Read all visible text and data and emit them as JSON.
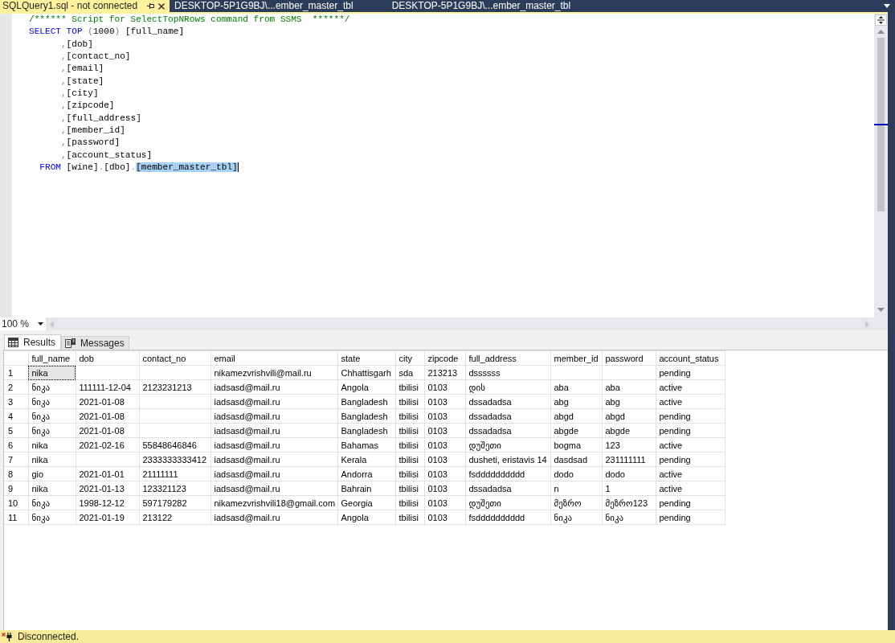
{
  "document_tabs": [
    {
      "label": "SQLQuery1.sql - not connected",
      "selected": true
    },
    {
      "label": "DESKTOP-5P1G9BJ\\...ember_master_tbl",
      "selected": false
    },
    {
      "label": "DESKTOP-5P1G9BJ\\...ember_master_tbl",
      "selected": false
    }
  ],
  "editor": {
    "lines": [
      {
        "tokens": [
          {
            "kind": "comment",
            "text": "/****** Script for SelectTopNRows command from SSMS  ******/",
            "selected": false
          }
        ]
      },
      {
        "tokens": [
          {
            "kind": "keyword",
            "text": "SELECT TOP",
            "selected": false
          },
          {
            "kind": "punct",
            "text": " (",
            "selected": false
          },
          {
            "kind": "plain",
            "text": "1000",
            "selected": false
          },
          {
            "kind": "punct",
            "text": ")",
            "selected": false
          },
          {
            "kind": "plain",
            "text": " [full_name]",
            "selected": false
          }
        ]
      },
      {
        "tokens": [
          {
            "kind": "punct",
            "text": "      ,",
            "selected": false
          },
          {
            "kind": "plain",
            "text": "[dob]",
            "selected": false
          }
        ]
      },
      {
        "tokens": [
          {
            "kind": "punct",
            "text": "      ,",
            "selected": false
          },
          {
            "kind": "plain",
            "text": "[contact_no]",
            "selected": false
          }
        ]
      },
      {
        "tokens": [
          {
            "kind": "punct",
            "text": "      ,",
            "selected": false
          },
          {
            "kind": "plain",
            "text": "[email]",
            "selected": false
          }
        ]
      },
      {
        "tokens": [
          {
            "kind": "punct",
            "text": "      ,",
            "selected": false
          },
          {
            "kind": "plain",
            "text": "[state]",
            "selected": false
          }
        ]
      },
      {
        "tokens": [
          {
            "kind": "punct",
            "text": "      ,",
            "selected": false
          },
          {
            "kind": "plain",
            "text": "[city]",
            "selected": false
          }
        ]
      },
      {
        "tokens": [
          {
            "kind": "punct",
            "text": "      ,",
            "selected": false
          },
          {
            "kind": "plain",
            "text": "[zipcode]",
            "selected": false
          }
        ]
      },
      {
        "tokens": [
          {
            "kind": "punct",
            "text": "      ,",
            "selected": false
          },
          {
            "kind": "plain",
            "text": "[full_address]",
            "selected": false
          }
        ]
      },
      {
        "tokens": [
          {
            "kind": "punct",
            "text": "      ,",
            "selected": false
          },
          {
            "kind": "plain",
            "text": "[member_id]",
            "selected": false
          }
        ]
      },
      {
        "tokens": [
          {
            "kind": "punct",
            "text": "      ,",
            "selected": false
          },
          {
            "kind": "plain",
            "text": "[password]",
            "selected": false
          }
        ]
      },
      {
        "tokens": [
          {
            "kind": "punct",
            "text": "      ,",
            "selected": false
          },
          {
            "kind": "plain",
            "text": "[account_status]",
            "selected": false
          }
        ]
      },
      {
        "tokens": [
          {
            "kind": "keyword",
            "text": "  FROM",
            "selected": false
          },
          {
            "kind": "plain",
            "text": " [wine]",
            "selected": false
          },
          {
            "kind": "punct",
            "text": ".",
            "selected": false
          },
          {
            "kind": "plain",
            "text": "[dbo]",
            "selected": false
          },
          {
            "kind": "punct",
            "text": ".",
            "selected": false
          },
          {
            "kind": "plain",
            "text": "[member_master_tbl]",
            "selected": true
          }
        ]
      }
    ]
  },
  "zoom": {
    "value": "100 %"
  },
  "result_tabs": [
    {
      "label": "Results",
      "kind": "grid",
      "selected": true
    },
    {
      "label": "Messages",
      "kind": "messages",
      "selected": false
    }
  ],
  "results": {
    "columns": [
      "full_name",
      "dob",
      "contact_no",
      "email",
      "state",
      "city",
      "zipcode",
      "full_address",
      "member_id",
      "password",
      "account_status"
    ],
    "rows": [
      {
        "number": "1",
        "cells": [
          {
            "text": "nika",
            "selected": true
          },
          {
            "selected": false
          },
          {
            "selected": false
          },
          {
            "text": "nikamezvrishvili@mail.ru",
            "selected": false
          },
          {
            "text": "Chhattisgarh",
            "selected": false
          },
          {
            "text": "sda",
            "selected": false
          },
          {
            "text": "213213",
            "selected": false
          },
          {
            "text": "dssssss",
            "selected": false
          },
          {
            "selected": false
          },
          {
            "selected": false
          },
          {
            "text": "pending",
            "selected": false
          }
        ]
      },
      {
        "number": "2",
        "cells": [
          {
            "text": "ნიკა",
            "selected": false
          },
          {
            "text": "111111-12-04",
            "selected": false
          },
          {
            "text": "2123231213",
            "selected": false
          },
          {
            "text": "iadsasd@mail.ru",
            "selected": false
          },
          {
            "text": "Angola",
            "selected": false
          },
          {
            "text": "tbilisi",
            "selected": false
          },
          {
            "text": "0103",
            "selected": false
          },
          {
            "text": "დის",
            "selected": false
          },
          {
            "text": "aba",
            "selected": false
          },
          {
            "text": "aba",
            "selected": false
          },
          {
            "text": "active",
            "selected": false
          }
        ]
      },
      {
        "number": "3",
        "cells": [
          {
            "text": "ნიკა",
            "selected": false
          },
          {
            "text": "2021-01-08",
            "selected": false
          },
          {
            "selected": false
          },
          {
            "text": "iadsasd@mail.ru",
            "selected": false
          },
          {
            "text": "Bangladesh",
            "selected": false
          },
          {
            "text": "tbilisi",
            "selected": false
          },
          {
            "text": "0103",
            "selected": false
          },
          {
            "text": "dssadadsa",
            "selected": false
          },
          {
            "text": "abg",
            "selected": false
          },
          {
            "text": "abg",
            "selected": false
          },
          {
            "text": "active",
            "selected": false
          }
        ]
      },
      {
        "number": "4",
        "cells": [
          {
            "text": "ნიკა",
            "selected": false
          },
          {
            "text": "2021-01-08",
            "selected": false
          },
          {
            "selected": false
          },
          {
            "text": "iadsasd@mail.ru",
            "selected": false
          },
          {
            "text": "Bangladesh",
            "selected": false
          },
          {
            "text": "tbilisi",
            "selected": false
          },
          {
            "text": "0103",
            "selected": false
          },
          {
            "text": "dssadadsa",
            "selected": false
          },
          {
            "text": "abgd",
            "selected": false
          },
          {
            "text": "abgd",
            "selected": false
          },
          {
            "text": "pending",
            "selected": false
          }
        ]
      },
      {
        "number": "5",
        "cells": [
          {
            "text": "ნიკა",
            "selected": false
          },
          {
            "text": "2021-01-08",
            "selected": false
          },
          {
            "selected": false
          },
          {
            "text": "iadsasd@mail.ru",
            "selected": false
          },
          {
            "text": "Bangladesh",
            "selected": false
          },
          {
            "text": "tbilisi",
            "selected": false
          },
          {
            "text": "0103",
            "selected": false
          },
          {
            "text": "dssadadsa",
            "selected": false
          },
          {
            "text": "abgde",
            "selected": false
          },
          {
            "text": "abgde",
            "selected": false
          },
          {
            "text": "pending",
            "selected": false
          }
        ]
      },
      {
        "number": "6",
        "cells": [
          {
            "text": "nika",
            "selected": false
          },
          {
            "text": "2021-02-16",
            "selected": false
          },
          {
            "text": "55848646846",
            "selected": false
          },
          {
            "text": "iadsasd@mail.ru",
            "selected": false
          },
          {
            "text": "Bahamas",
            "selected": false
          },
          {
            "text": "tbilisi",
            "selected": false
          },
          {
            "text": "0103",
            "selected": false
          },
          {
            "text": "დუშეთი",
            "selected": false
          },
          {
            "text": "bogma",
            "selected": false
          },
          {
            "text": "123",
            "selected": false
          },
          {
            "text": "active",
            "selected": false
          }
        ]
      },
      {
        "number": "7",
        "cells": [
          {
            "text": "nika",
            "selected": false
          },
          {
            "selected": false
          },
          {
            "text": "2333333333412",
            "selected": false
          },
          {
            "text": "iadsasd@mail.ru",
            "selected": false
          },
          {
            "text": "Kerala",
            "selected": false
          },
          {
            "text": "tbilisi",
            "selected": false
          },
          {
            "text": "0103",
            "selected": false
          },
          {
            "text": "dusheti, eristavis 14",
            "selected": false
          },
          {
            "text": "dasdsad",
            "selected": false
          },
          {
            "text": "231111111",
            "selected": false
          },
          {
            "text": "pending",
            "selected": false
          }
        ]
      },
      {
        "number": "8",
        "cells": [
          {
            "text": "gio",
            "selected": false
          },
          {
            "text": "2021-01-01",
            "selected": false
          },
          {
            "text": "21111111",
            "selected": false
          },
          {
            "text": "iadsasd@mail.ru",
            "selected": false
          },
          {
            "text": "Andorra",
            "selected": false
          },
          {
            "text": "tbilisi",
            "selected": false
          },
          {
            "text": "0103",
            "selected": false
          },
          {
            "text": "fsdddddddddd",
            "selected": false
          },
          {
            "text": "dodo",
            "selected": false
          },
          {
            "text": "dodo",
            "selected": false
          },
          {
            "text": "active",
            "selected": false
          }
        ]
      },
      {
        "number": "9",
        "cells": [
          {
            "text": "nika",
            "selected": false
          },
          {
            "text": "2021-01-13",
            "selected": false
          },
          {
            "text": "123321123",
            "selected": false
          },
          {
            "text": "iadsasd@mail.ru",
            "selected": false
          },
          {
            "text": "Bahrain",
            "selected": false
          },
          {
            "text": "tbilisi",
            "selected": false
          },
          {
            "text": "0103",
            "selected": false
          },
          {
            "text": "dssadadsa",
            "selected": false
          },
          {
            "text": "n",
            "selected": false
          },
          {
            "text": "1",
            "selected": false
          },
          {
            "text": "active",
            "selected": false
          }
        ]
      },
      {
        "number": "10",
        "cells": [
          {
            "text": "ნიკა",
            "selected": false
          },
          {
            "text": "1998-12-12",
            "selected": false
          },
          {
            "text": "597179282",
            "selected": false
          },
          {
            "text": "nikamezvrishvili18@gmail.com",
            "selected": false
          },
          {
            "text": "Georgia",
            "selected": false
          },
          {
            "text": "tbilisi",
            "selected": false
          },
          {
            "text": "0103",
            "selected": false
          },
          {
            "text": "დუშეთი",
            "selected": false
          },
          {
            "text": "მეზრო",
            "selected": false
          },
          {
            "text": "მეზრო123",
            "selected": false
          },
          {
            "text": "pending",
            "selected": false
          }
        ]
      },
      {
        "number": "11",
        "cells": [
          {
            "text": "ნიკა",
            "selected": false
          },
          {
            "text": "2021-01-19",
            "selected": false
          },
          {
            "text": "213122",
            "selected": false
          },
          {
            "text": "iadsasd@mail.ru",
            "selected": false
          },
          {
            "text": "Angola",
            "selected": false
          },
          {
            "text": "tbilisi",
            "selected": false
          },
          {
            "text": "0103",
            "selected": false
          },
          {
            "text": "fsdddddddddd",
            "selected": false
          },
          {
            "text": "ნიკა",
            "selected": false
          },
          {
            "text": "ნიკა",
            "selected": false
          },
          {
            "text": "pending",
            "selected": false
          }
        ]
      }
    ]
  },
  "status_bar": {
    "text": "Disconnected."
  }
}
